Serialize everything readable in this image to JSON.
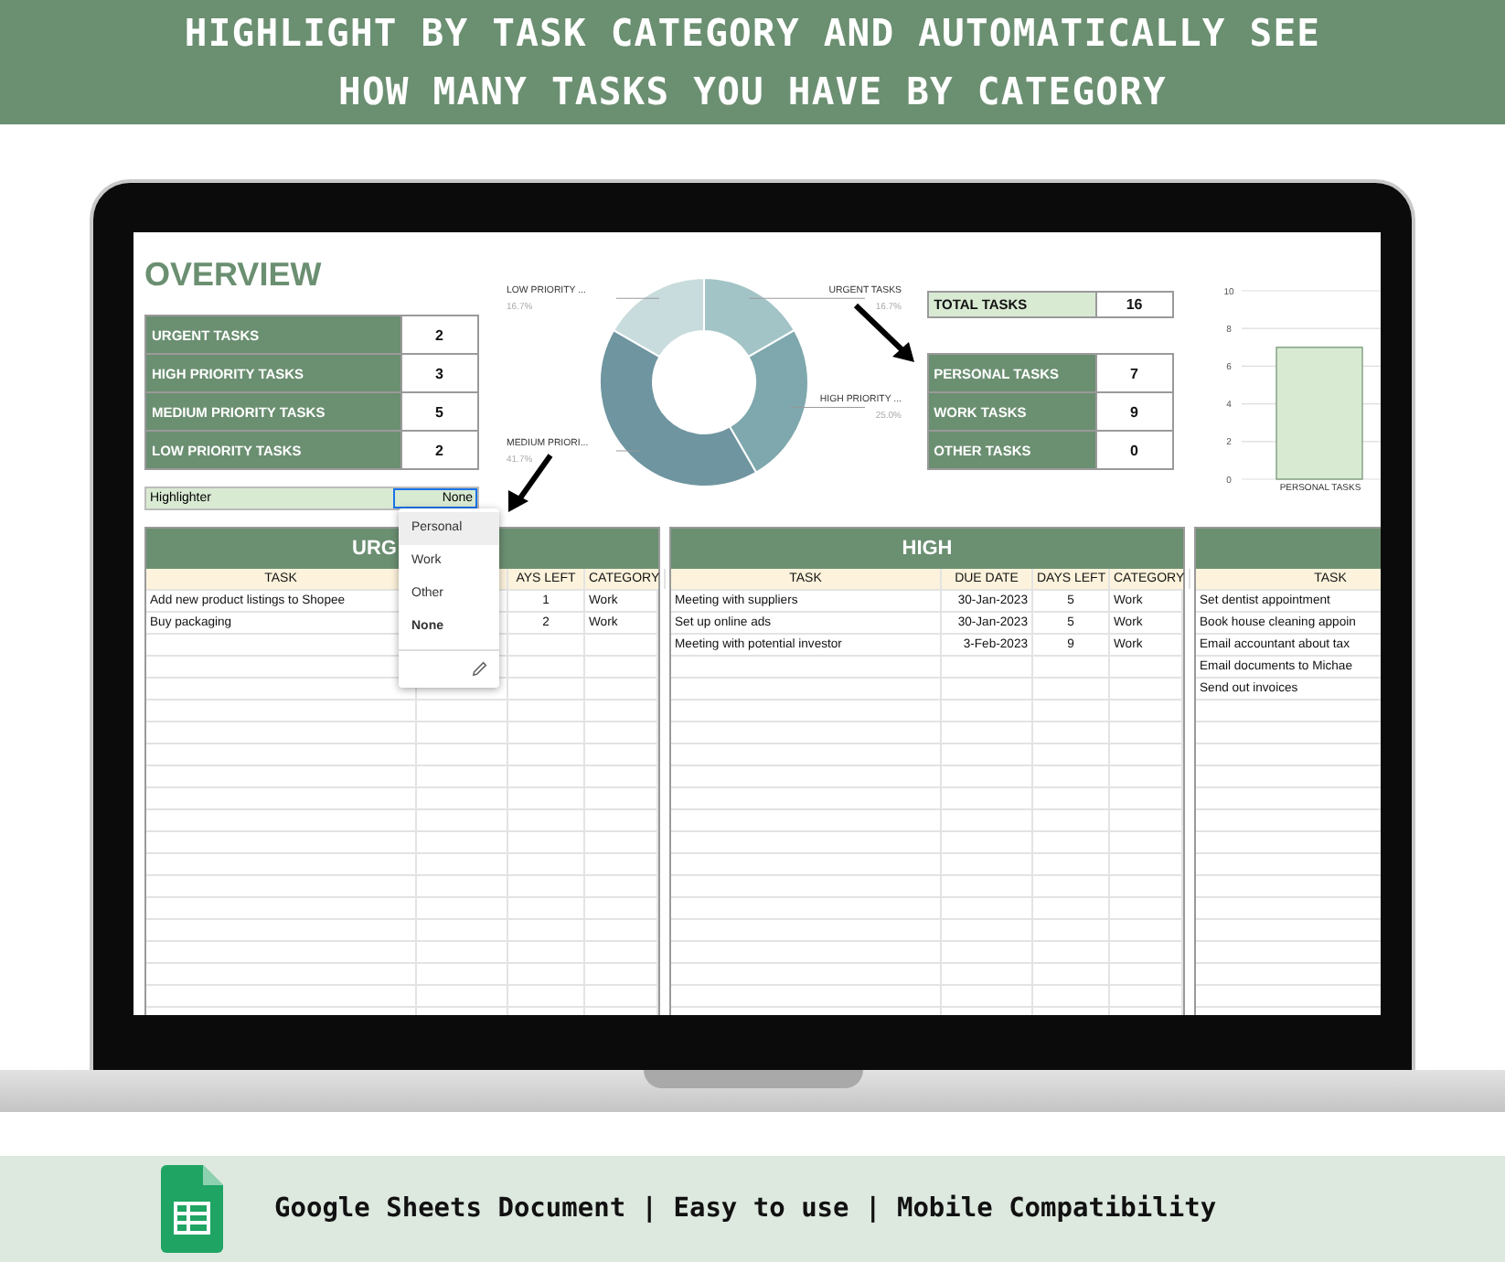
{
  "banner": {
    "lines": [
      "HIGHLIGHT BY TASK CATEGORY AND AUTOMATICALLY SEE",
      "HOW MANY TASKS YOU HAVE BY CATEGORY"
    ]
  },
  "overview": {
    "title": "OVERVIEW",
    "priority_counts": [
      {
        "label": "URGENT TASKS",
        "value": "2"
      },
      {
        "label": "HIGH PRIORITY TASKS",
        "value": "3"
      },
      {
        "label": "MEDIUM PRIORITY TASKS",
        "value": "5"
      },
      {
        "label": "LOW PRIORITY TASKS",
        "value": "2"
      }
    ],
    "highlighter": {
      "label": "Highlighter",
      "value": "None"
    }
  },
  "priority_chart": {
    "chart_data": {
      "type": "donut",
      "categories": [
        "URGENT TASKS",
        "HIGH PRIORITY ...",
        "MEDIUM PRIORI...",
        "LOW PRIORITY ..."
      ],
      "series": [
        {
          "values": [
            16.7,
            25.0,
            41.7,
            16.7
          ]
        }
      ],
      "colors": [
        "#a3c4c6",
        "#7ea8ad",
        "#6f95a0",
        "#c9dcdd"
      ],
      "value_labels": [
        "16.7%",
        "25.0%",
        "41.7%",
        "16.7%"
      ]
    }
  },
  "total": {
    "label": "TOTAL TASKS",
    "value": "16"
  },
  "category_counts": [
    {
      "label": "PERSONAL TASKS",
      "value": "7"
    },
    {
      "label": "WORK TASKS",
      "value": "9"
    },
    {
      "label": "OTHER TASKS",
      "value": "0"
    }
  ],
  "category_chart": {
    "chart_data": {
      "type": "bar",
      "categories": [
        "PERSONAL TASKS"
      ],
      "series": [
        {
          "color": "#d9ead3",
          "values": [
            7
          ]
        }
      ],
      "grid": true,
      "ylim": [
        0,
        10
      ],
      "yticks": [
        0,
        2,
        4,
        6,
        8,
        10
      ]
    }
  },
  "dropdown": {
    "options": [
      {
        "label": "Personal",
        "selected": false,
        "highlighted": true
      },
      {
        "label": "Work",
        "selected": false,
        "highlighted": false
      },
      {
        "label": "Other",
        "selected": false,
        "highlighted": false
      },
      {
        "label": "None",
        "selected": true,
        "highlighted": false
      }
    ]
  },
  "panels": [
    {
      "title": "URG",
      "headers": {
        "task": "TASK",
        "days_left": "AYS LEFT",
        "category": "CATEGORY"
      },
      "rows": [
        {
          "task": "Add new product listings to Shopee",
          "days_left": "1",
          "category": "Work"
        },
        {
          "task": "Buy packaging",
          "days_left": "2",
          "category": "Work"
        }
      ]
    },
    {
      "title": "HIGH",
      "headers": {
        "task": "TASK",
        "due_date": "DUE DATE",
        "days_left": "DAYS LEFT",
        "category": "CATEGORY"
      },
      "rows": [
        {
          "task": "Meeting with suppliers",
          "due_date": "30-Jan-2023",
          "days_left": "5",
          "category": "Work"
        },
        {
          "task": "Set up online ads",
          "due_date": "30-Jan-2023",
          "days_left": "5",
          "category": "Work"
        },
        {
          "task": "Meeting with potential investor",
          "due_date": "3-Feb-2023",
          "days_left": "9",
          "category": "Work"
        }
      ]
    },
    {
      "headers": {
        "task": "TASK"
      },
      "rows": [
        {
          "task": "Set dentist appointment"
        },
        {
          "task": "Book house cleaning appoin"
        },
        {
          "task": "Email accountant about tax"
        },
        {
          "task": "Email documents to Michae"
        },
        {
          "task": "Send out invoices"
        }
      ]
    }
  ],
  "footer": {
    "text": "Google Sheets Document | Easy to use | Mobile Compatibility"
  }
}
